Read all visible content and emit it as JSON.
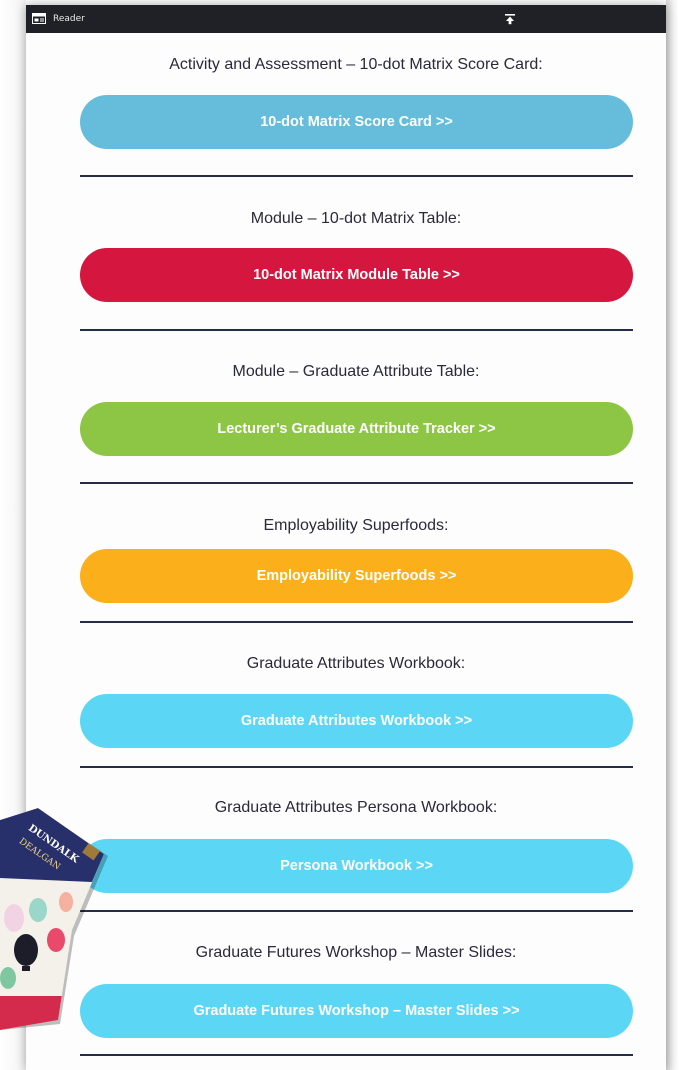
{
  "window": {
    "title": "Reader",
    "icons": {
      "reader": "reader-view-icon",
      "pin": "pin-icon"
    }
  },
  "sections": [
    {
      "title": "Activity and Assessment – 10-dot Matrix Score Card:",
      "button": "10-dot Matrix Score Card >>",
      "color": "#66bddb"
    },
    {
      "title": "Module – 10-dot Matrix Table:",
      "button": "10-dot Matrix Module Table >>",
      "color": "#d5173f"
    },
    {
      "title": "Module – Graduate Attribute Table:",
      "button": "Lecturer’s Graduate Attribute Tracker >>",
      "color": "#8dc545"
    },
    {
      "title": "Employability Superfoods:",
      "button": "Employability Superfoods >>",
      "color": "#fbaf1a"
    },
    {
      "title": "Graduate Attributes Workbook:",
      "button": "Graduate Attributes Workbook >>",
      "color": "#5bd7f5"
    },
    {
      "title": "Graduate Attributes Persona Workbook:",
      "button": "Persona Workbook >>",
      "color": "#5bd7f5"
    },
    {
      "title": "Graduate Futures Workshop – Master Slides:",
      "button": "Graduate Futures Workshop – Master Slides >>",
      "color": "#5bd7f5"
    }
  ],
  "brochure": {
    "line1": "DUNDALK",
    "line2": "DEALGAN",
    "icon": "brochure-cover-image"
  }
}
